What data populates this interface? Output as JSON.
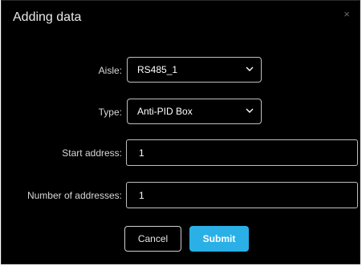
{
  "dialog": {
    "title": "Adding data",
    "close_glyph": "×"
  },
  "form": {
    "aisle": {
      "label": "Aisle:",
      "value": "RS485_1"
    },
    "type": {
      "label": "Type:",
      "value": "Anti-PID Box"
    },
    "start_address": {
      "label": "Start address:",
      "value": "1"
    },
    "number_of_addresses": {
      "label": "Number of addresses:",
      "value": "1"
    }
  },
  "buttons": {
    "cancel_label": "Cancel",
    "submit_label": "Submit"
  },
  "colors": {
    "background": "#000000",
    "accent": "#2ab0e6",
    "border": "#bfbfbf",
    "text": "#ffffff"
  },
  "icons": [
    "close-icon",
    "chevron-down-icon"
  ]
}
